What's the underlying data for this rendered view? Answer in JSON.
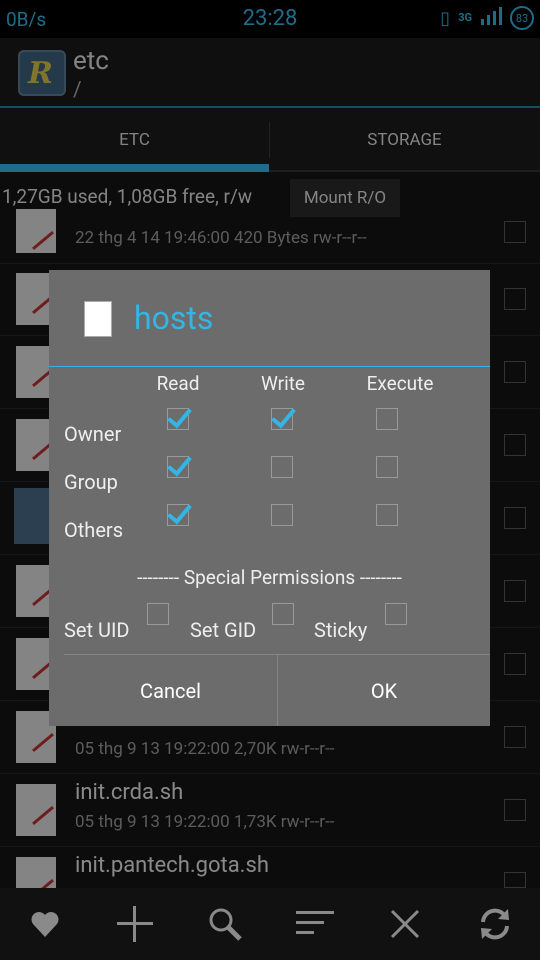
{
  "status_bar": {
    "network_speed": "0B/s",
    "time": "23:28",
    "network_type": "3G",
    "battery": "83"
  },
  "action_bar": {
    "title": "etc",
    "subtitle": "/"
  },
  "tabs": [
    {
      "label": "ETC",
      "active": true
    },
    {
      "label": "STORAGE",
      "active": false
    }
  ],
  "storage": {
    "info": "1,27GB used, 1,08GB free, r/w",
    "mount_button": "Mount R/O"
  },
  "files": [
    {
      "name": "",
      "meta": "22 thg 4 14 19:46:00  420 Bytes  rw-r--r--"
    },
    {
      "name": "init.crda.sh",
      "meta": "05 thg 9 13 19:22:00  1,73K  rw-r--r--"
    },
    {
      "name": "init.pantech.gota.sh",
      "meta": ""
    },
    {
      "name": "",
      "meta": "05 thg 9 13 19:22:00  2,70K  rw-r--r--"
    }
  ],
  "dialog": {
    "title": "hosts",
    "columns": [
      "Read",
      "Write",
      "Execute"
    ],
    "rows": [
      {
        "label": "Owner",
        "checks": [
          true,
          true,
          false
        ]
      },
      {
        "label": "Group",
        "checks": [
          true,
          false,
          false
        ]
      },
      {
        "label": "Others",
        "checks": [
          true,
          false,
          false
        ]
      }
    ],
    "special_title": "-------- Special Permissions --------",
    "special": [
      {
        "label": "Set UID",
        "checked": false
      },
      {
        "label": "Set GID",
        "checked": false
      },
      {
        "label": "Sticky",
        "checked": false
      }
    ],
    "cancel_label": "Cancel",
    "ok_label": "OK"
  },
  "toolbar": {
    "icons": [
      "favorite-icon",
      "add-icon",
      "search-icon",
      "sort-icon",
      "close-icon",
      "refresh-icon"
    ]
  },
  "colors": {
    "accent": "#33b5e5",
    "dialog_bg": "#6c6c6c"
  }
}
